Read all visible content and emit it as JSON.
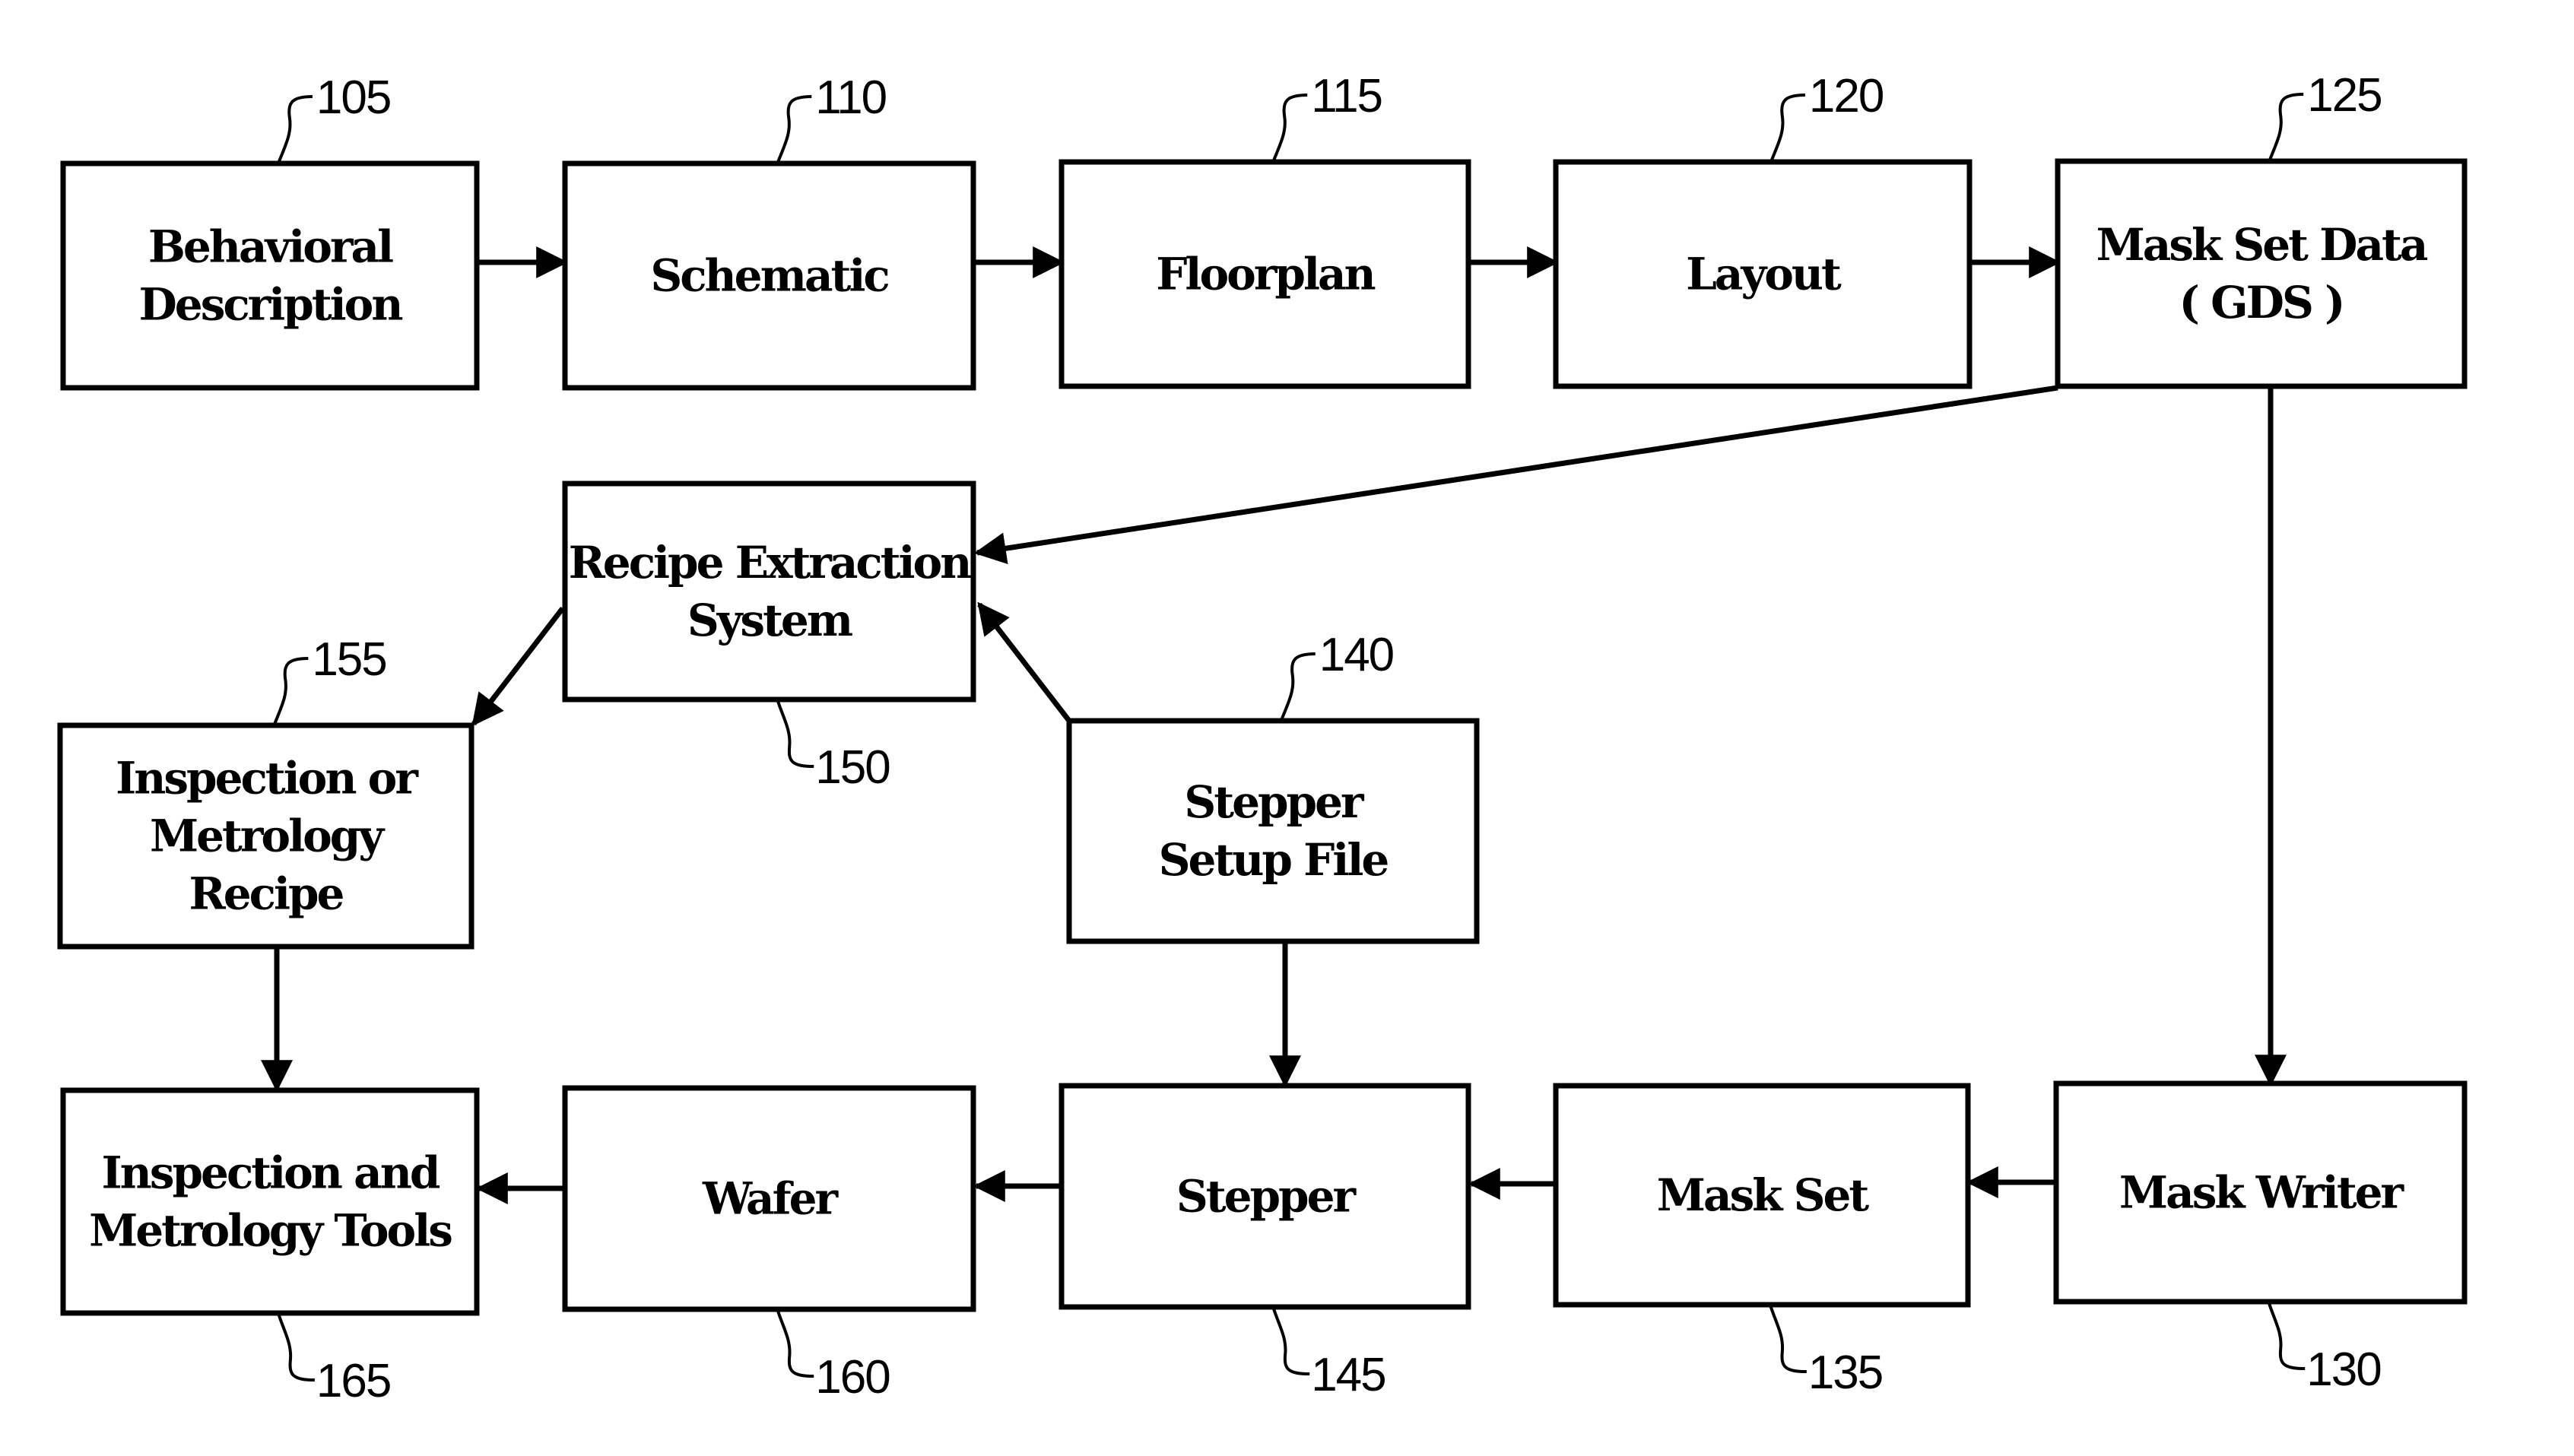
{
  "diagram": {
    "nodes": [
      {
        "id": "105",
        "lines": [
          "Behavioral",
          "Description"
        ]
      },
      {
        "id": "110",
        "lines": [
          "Schematic"
        ]
      },
      {
        "id": "115",
        "lines": [
          "Floorplan"
        ]
      },
      {
        "id": "120",
        "lines": [
          "Layout"
        ]
      },
      {
        "id": "125",
        "lines": [
          "Mask Set Data",
          "( GDS )"
        ]
      },
      {
        "id": "150",
        "lines": [
          "Recipe Extraction",
          "System"
        ]
      },
      {
        "id": "155",
        "lines": [
          "Inspection or",
          "Metrology",
          "Recipe"
        ]
      },
      {
        "id": "140",
        "lines": [
          "Stepper",
          "Setup File"
        ]
      },
      {
        "id": "165",
        "lines": [
          "Inspection and",
          "Metrology Tools"
        ]
      },
      {
        "id": "160",
        "lines": [
          "Wafer"
        ]
      },
      {
        "id": "145",
        "lines": [
          "Stepper"
        ]
      },
      {
        "id": "135",
        "lines": [
          "Mask Set"
        ]
      },
      {
        "id": "130",
        "lines": [
          "Mask Writer"
        ]
      }
    ],
    "edges": [
      {
        "from": "105",
        "to": "110"
      },
      {
        "from": "110",
        "to": "115"
      },
      {
        "from": "115",
        "to": "120"
      },
      {
        "from": "120",
        "to": "125"
      },
      {
        "from": "125",
        "to": "150"
      },
      {
        "from": "125",
        "to": "130"
      },
      {
        "from": "140",
        "to": "150"
      },
      {
        "from": "150",
        "to": "155"
      },
      {
        "from": "155",
        "to": "165"
      },
      {
        "from": "140",
        "to": "145"
      },
      {
        "from": "130",
        "to": "135"
      },
      {
        "from": "135",
        "to": "145"
      },
      {
        "from": "145",
        "to": "160"
      },
      {
        "from": "160",
        "to": "165"
      }
    ]
  }
}
